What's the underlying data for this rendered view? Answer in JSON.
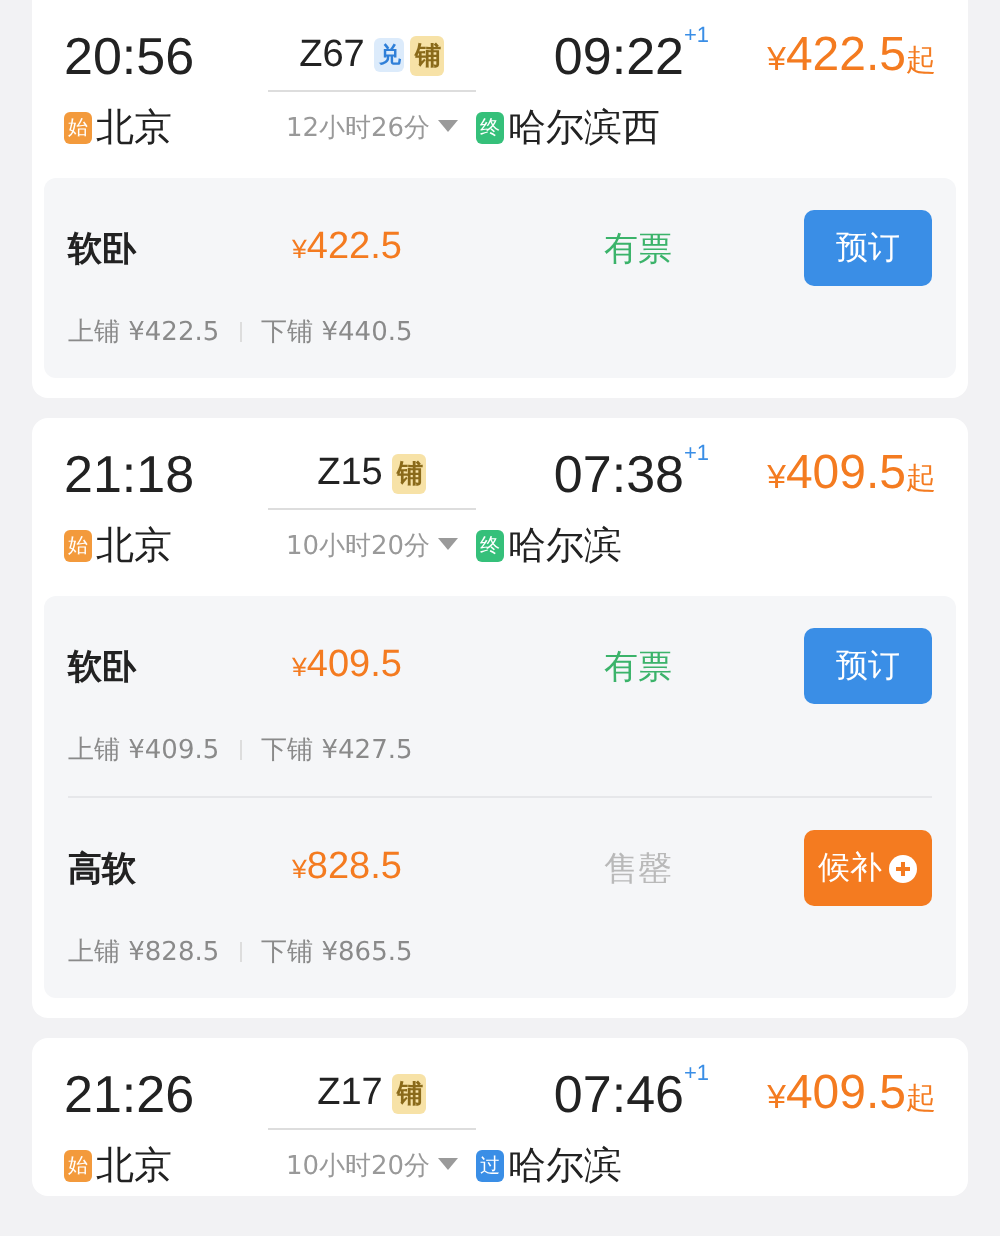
{
  "trains": [
    {
      "depart_time": "20:56",
      "train_no": "Z67",
      "badges": [
        {
          "text": "兑",
          "kind": "exchange"
        },
        {
          "text": "铺",
          "kind": "berth"
        }
      ],
      "arrive_time": "09:22",
      "day_offset": "+1",
      "currency": "¥",
      "price": "422.5",
      "price_suffix": "起",
      "origin": {
        "tag": "始",
        "kind": "start",
        "name": "北京"
      },
      "duration": "12小时26分",
      "destination": {
        "tag": "终",
        "kind": "end",
        "name": "哈尔滨西"
      },
      "seats": [
        {
          "name": "软卧",
          "currency": "¥",
          "price": "422.5",
          "status": "有票",
          "available": true,
          "action": {
            "label": "预订",
            "kind": "book"
          },
          "berths": [
            "上铺 ¥422.5",
            "下铺 ¥440.5"
          ]
        }
      ]
    },
    {
      "depart_time": "21:18",
      "train_no": "Z15",
      "badges": [
        {
          "text": "铺",
          "kind": "berth"
        }
      ],
      "arrive_time": "07:38",
      "day_offset": "+1",
      "currency": "¥",
      "price": "409.5",
      "price_suffix": "起",
      "origin": {
        "tag": "始",
        "kind": "start",
        "name": "北京"
      },
      "duration": "10小时20分",
      "destination": {
        "tag": "终",
        "kind": "end",
        "name": "哈尔滨"
      },
      "seats": [
        {
          "name": "软卧",
          "currency": "¥",
          "price": "409.5",
          "status": "有票",
          "available": true,
          "action": {
            "label": "预订",
            "kind": "book"
          },
          "berths": [
            "上铺 ¥409.5",
            "下铺 ¥427.5"
          ]
        },
        {
          "name": "高软",
          "currency": "¥",
          "price": "828.5",
          "status": "售罄",
          "available": false,
          "action": {
            "label": "候补",
            "kind": "waitlist"
          },
          "berths": [
            "上铺 ¥828.5",
            "下铺 ¥865.5"
          ]
        }
      ]
    },
    {
      "depart_time": "21:26",
      "train_no": "Z17",
      "badges": [
        {
          "text": "铺",
          "kind": "berth"
        }
      ],
      "arrive_time": "07:46",
      "day_offset": "+1",
      "currency": "¥",
      "price": "409.5",
      "price_suffix": "起",
      "origin": {
        "tag": "始",
        "kind": "start",
        "name": "北京"
      },
      "duration": "10小时20分",
      "destination": {
        "tag": "过",
        "kind": "pass",
        "name": "哈尔滨"
      }
    }
  ]
}
